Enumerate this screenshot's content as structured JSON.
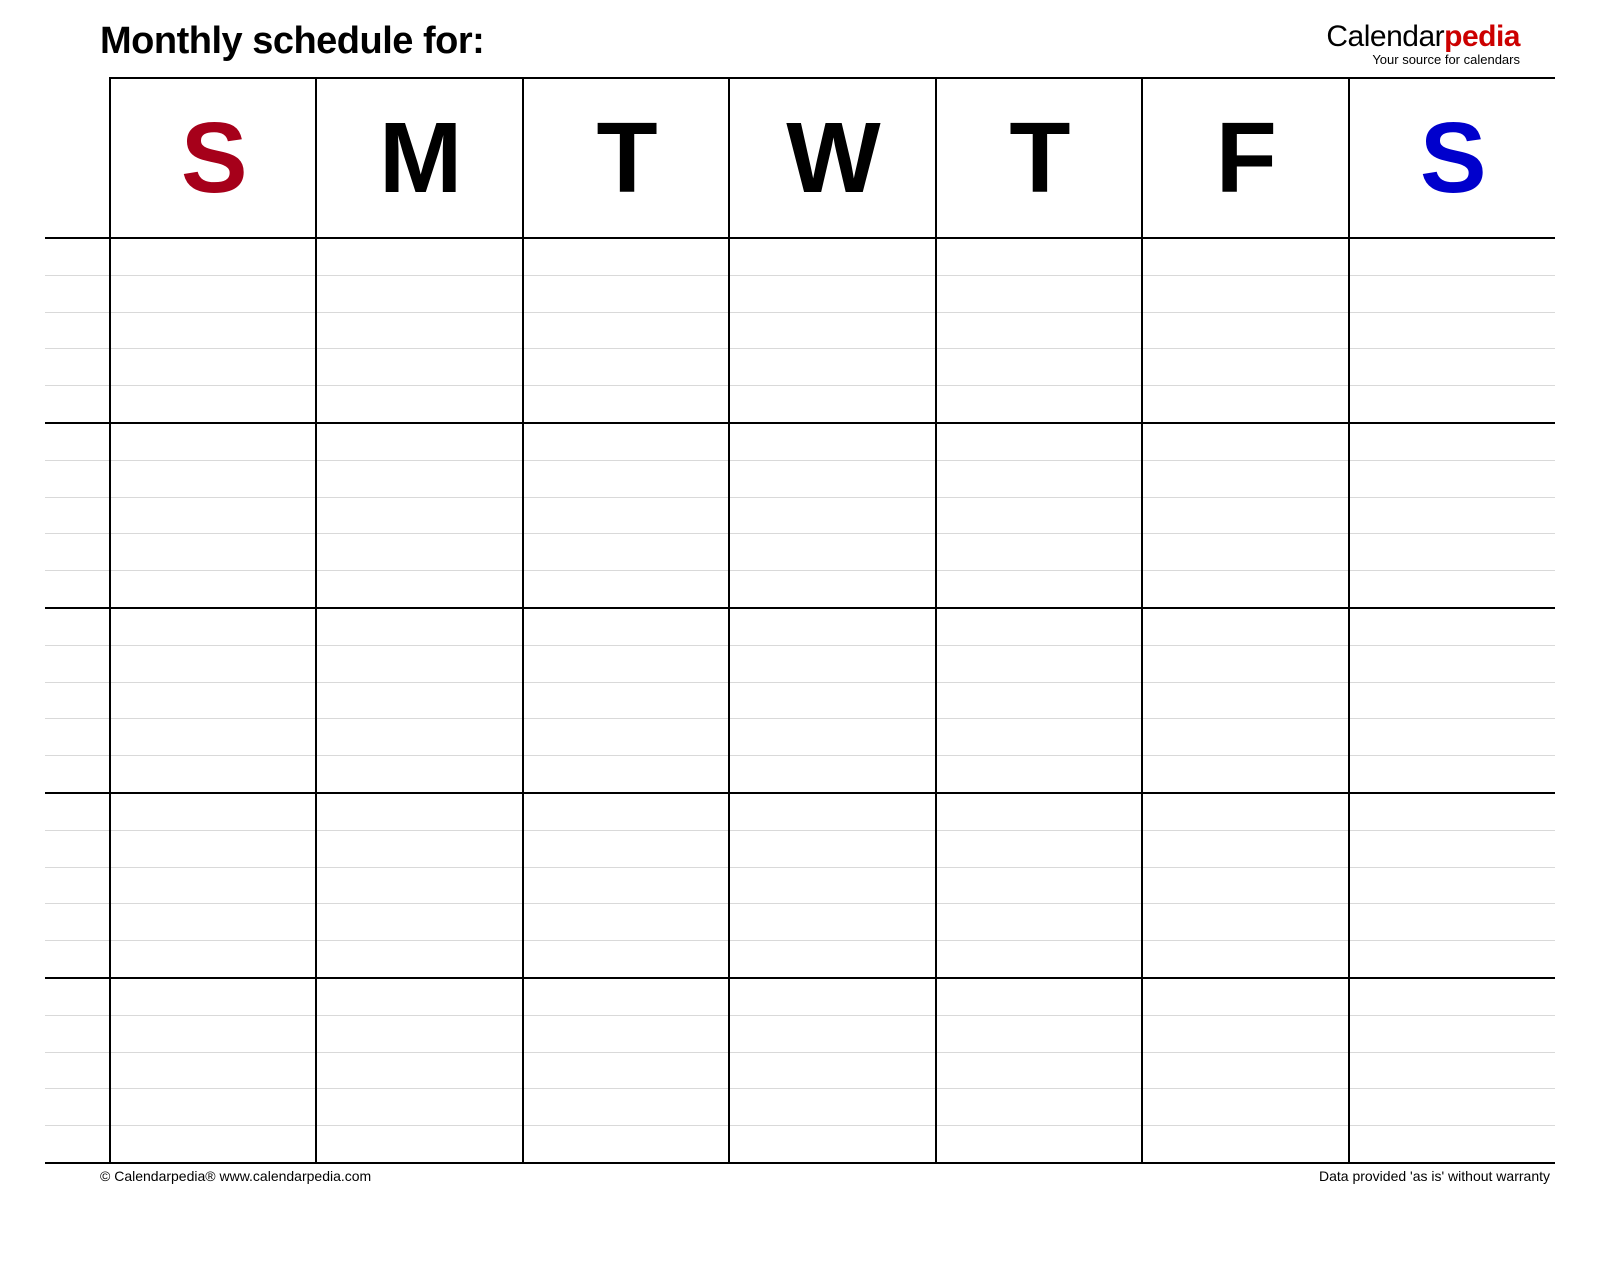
{
  "header": {
    "title": "Monthly schedule for:"
  },
  "logo": {
    "part1": "Calendar",
    "part2": "pedia",
    "tagline": "Your source for calendars"
  },
  "days": [
    {
      "letter": "S",
      "class": "day-sun"
    },
    {
      "letter": "M",
      "class": "day-mon"
    },
    {
      "letter": "T",
      "class": "day-tue"
    },
    {
      "letter": "W",
      "class": "day-wed"
    },
    {
      "letter": "T",
      "class": "day-thu"
    },
    {
      "letter": "F",
      "class": "day-fri"
    },
    {
      "letter": "S",
      "class": "day-sat"
    }
  ],
  "weeks": 5,
  "subrowsPerWeek": 5,
  "footer": {
    "left": "© Calendarpedia®   www.calendarpedia.com",
    "right": "Data provided 'as is' without warranty"
  }
}
